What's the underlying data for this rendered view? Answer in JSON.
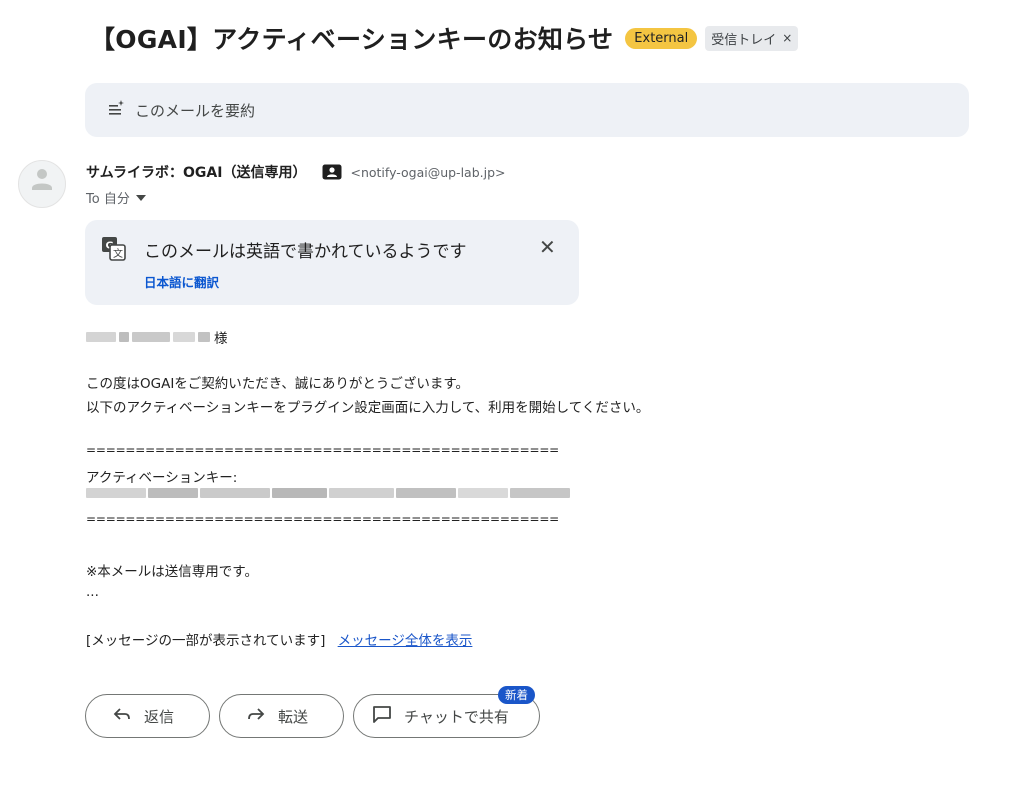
{
  "subject": "【OGAI】アクティベーションキーのお知らせ",
  "labels": {
    "external": "External",
    "inbox": "受信トレイ",
    "remove": "×"
  },
  "summary": {
    "label": "このメールを要約"
  },
  "sender": {
    "name": "サムライラボ：OGAI（送信専用）",
    "email": "<notify-ogai@up-lab.jp>"
  },
  "recipient": {
    "label": "To 自分"
  },
  "translate": {
    "message": "このメールは英語で書かれているようです",
    "action": "日本語に翻訳",
    "close": "✕"
  },
  "body": {
    "salutation_suffix": "様",
    "line1": "この度はOGAIをご契約いただき、誠にありがとうございます。",
    "line2": "以下のアクティベーションキーをプラグイン設定画面に入力して、利用を開始してください。",
    "separator": "================================================",
    "key_label": "アクティベーションキー:",
    "notice": "※本メールは送信専用です。",
    "ellipsis": "...",
    "clipped_text": "[メッセージの一部が表示されています]",
    "view_full": "メッセージ全体を表示"
  },
  "actions": {
    "reply": "返信",
    "forward": "転送",
    "share_chat": "チャットで共有",
    "new_badge": "新着"
  },
  "colors": {
    "external_badge": "#f4c542",
    "link": "#1a56c9",
    "card_bg": "#eef1f6"
  },
  "icons": [
    "sparkle-list-icon",
    "avatar-person-icon",
    "contact-card-icon",
    "caret-down-icon",
    "translate-icon",
    "close-icon",
    "reply-icon",
    "forward-icon",
    "chat-icon"
  ]
}
